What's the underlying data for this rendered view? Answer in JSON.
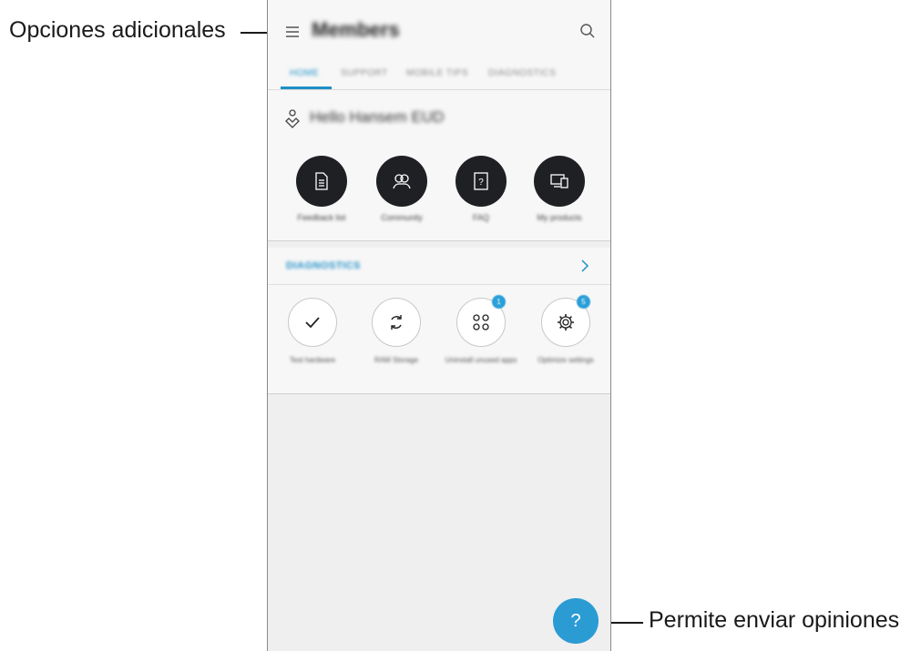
{
  "callouts": {
    "menu": "Opciones adicionales",
    "feedback": "Permite enviar opiniones"
  },
  "appbar": {
    "title": "Members",
    "menu_icon": "hamburger-icon",
    "search_icon": "search-icon"
  },
  "tabs": [
    {
      "label": "HOME",
      "active": true
    },
    {
      "label": "SUPPORT",
      "active": false
    },
    {
      "label": "MOBILE TIPS",
      "active": false
    },
    {
      "label": "DIAGNOSTICS",
      "active": false
    }
  ],
  "greeting": "Hello Hansem EUD",
  "shortcuts": [
    {
      "label": "Feedback list",
      "icon": "document-icon"
    },
    {
      "label": "Community",
      "icon": "people-icon"
    },
    {
      "label": "FAQ",
      "icon": "faq-icon"
    },
    {
      "label": "My products",
      "icon": "devices-icon"
    }
  ],
  "diagnostics": {
    "title": "DIAGNOSTICS",
    "items": [
      {
        "label": "Test hardware",
        "icon": "check-icon",
        "badge": ""
      },
      {
        "label": "RAM Storage",
        "icon": "refresh-icon",
        "badge": ""
      },
      {
        "label": "Uninstall unused apps",
        "icon": "apps-icon",
        "badge": "1"
      },
      {
        "label": "Optimize settings",
        "icon": "gear-icon",
        "badge": "5"
      }
    ]
  },
  "fab": {
    "label": "?"
  },
  "colors": {
    "accent": "#1e8fc8",
    "fab": "#2b9bd4",
    "dark_circle": "#1f2023"
  }
}
